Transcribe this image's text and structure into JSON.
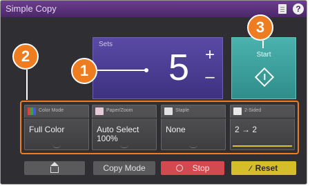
{
  "window": {
    "title": "Simple Copy"
  },
  "sets": {
    "label": "Sets",
    "value": "5",
    "plus": "+",
    "minus": "–"
  },
  "start": {
    "label": "Start"
  },
  "functions": [
    {
      "title": "Color Mode",
      "value": "Full Color",
      "value2": "",
      "icon": "color-mode-icon",
      "icon_color": "#d0d6dc"
    },
    {
      "title": "Paper/Zoom",
      "value": "Auto Select",
      "value2": "100%",
      "icon": "paper-zoom-icon",
      "icon_color": "#e8c9d8"
    },
    {
      "title": "Staple",
      "value": "None",
      "value2": "",
      "icon": "staple-icon",
      "icon_color": "#e2e2e2"
    },
    {
      "title": "2-Sided",
      "value": "2 → 2",
      "value2": "",
      "icon": "two-sided-icon",
      "icon_color": "#e8e8e8"
    }
  ],
  "bottom": {
    "copy_mode": "Copy Mode",
    "stop": "Stop",
    "reset": "Reset"
  },
  "callouts": [
    "1",
    "2",
    "3"
  ],
  "colors": {
    "title_bar": "#5a3278",
    "sets_panel": "#4b3e94",
    "start": "#3fa3a0",
    "stop": "#d24a4f",
    "reset": "#d6bd2a",
    "callout": "#ee7d22"
  }
}
